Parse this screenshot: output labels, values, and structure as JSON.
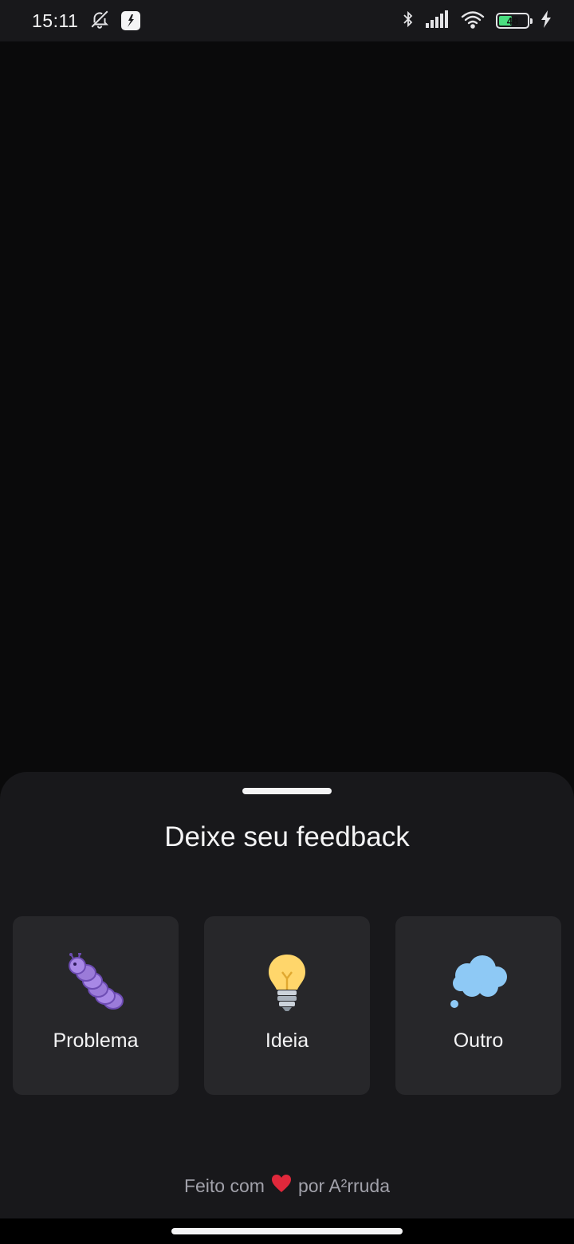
{
  "status_bar": {
    "time": "15:11",
    "icons": [
      "bell-off-icon",
      "app-notification-icon",
      "bluetooth-icon",
      "signal-icon",
      "wifi-icon",
      "battery-icon",
      "charging-icon"
    ],
    "battery_level": "48",
    "battery_fraction": 0.48,
    "battery_color": "#4ade80"
  },
  "sheet": {
    "title": "Deixe seu feedback",
    "options": [
      {
        "label": "Problema",
        "icon": "caterpillar-bug-icon"
      },
      {
        "label": "Ideia",
        "icon": "light-bulb-icon"
      },
      {
        "label": "Outro",
        "icon": "thought-balloon-icon"
      }
    ],
    "footer": {
      "prefix": "Feito com",
      "heart_icon": "heart-icon",
      "suffix": "por A²rruda"
    }
  },
  "colors": {
    "background": "#0a0a0b",
    "sheet": "#18181b",
    "card": "#27272a",
    "text": "#f4f4f5",
    "muted_text": "#a1a1aa"
  }
}
